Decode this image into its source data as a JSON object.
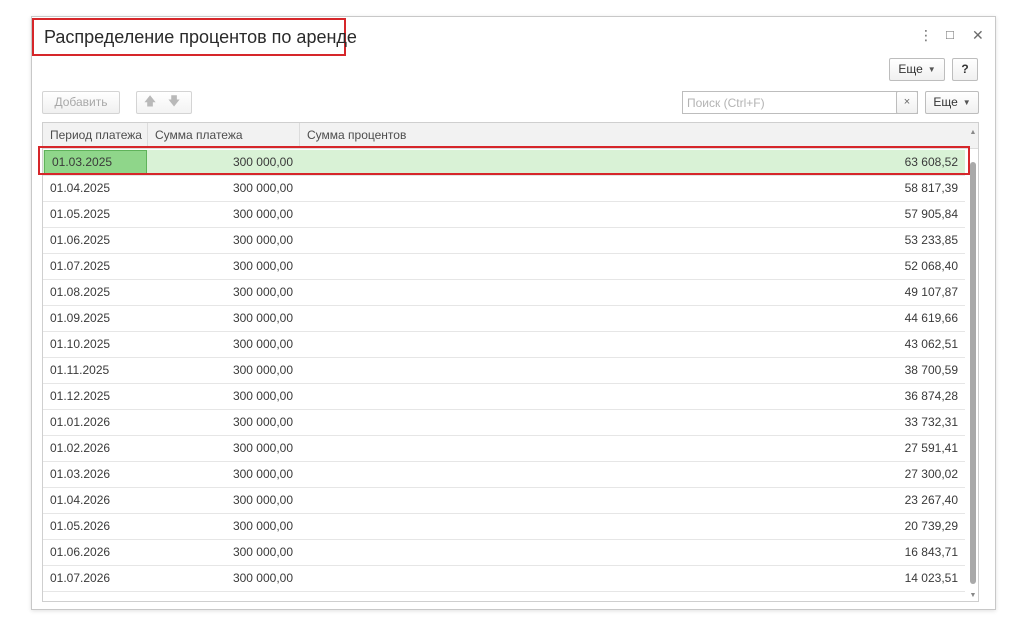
{
  "window": {
    "title": "Распределение процентов по аренде",
    "menu_icon": "⋮",
    "maximize_icon": "□",
    "close_icon": "✕"
  },
  "top_toolbar": {
    "more_label": "Еще",
    "help_label": "?"
  },
  "toolbar": {
    "add_label": "Добавить",
    "move_up_icon": "🡅",
    "move_down_icon": "🡇",
    "search_placeholder": "Поиск (Ctrl+F)",
    "search_clear_icon": "×",
    "more_label": "Еще"
  },
  "table": {
    "columns": [
      "Период платежа",
      "Сумма платежа",
      "Сумма процентов"
    ],
    "rows": [
      {
        "period": "01.03.2025",
        "payment": "300 000,00",
        "interest": "63 608,52"
      },
      {
        "period": "01.04.2025",
        "payment": "300 000,00",
        "interest": "58 817,39"
      },
      {
        "period": "01.05.2025",
        "payment": "300 000,00",
        "interest": "57 905,84"
      },
      {
        "period": "01.06.2025",
        "payment": "300 000,00",
        "interest": "53 233,85"
      },
      {
        "period": "01.07.2025",
        "payment": "300 000,00",
        "interest": "52 068,40"
      },
      {
        "period": "01.08.2025",
        "payment": "300 000,00",
        "interest": "49 107,87"
      },
      {
        "period": "01.09.2025",
        "payment": "300 000,00",
        "interest": "44 619,66"
      },
      {
        "period": "01.10.2025",
        "payment": "300 000,00",
        "interest": "43 062,51"
      },
      {
        "period": "01.11.2025",
        "payment": "300 000,00",
        "interest": "38 700,59"
      },
      {
        "period": "01.12.2025",
        "payment": "300 000,00",
        "interest": "36 874,28"
      },
      {
        "period": "01.01.2026",
        "payment": "300 000,00",
        "interest": "33 732,31"
      },
      {
        "period": "01.02.2026",
        "payment": "300 000,00",
        "interest": "27 591,41"
      },
      {
        "period": "01.03.2026",
        "payment": "300 000,00",
        "interest": "27 300,02"
      },
      {
        "period": "01.04.2026",
        "payment": "300 000,00",
        "interest": "23 267,40"
      },
      {
        "period": "01.05.2026",
        "payment": "300 000,00",
        "interest": "20 739,29"
      },
      {
        "period": "01.06.2026",
        "payment": "300 000,00",
        "interest": "16 843,71"
      },
      {
        "period": "01.07.2026",
        "payment": "300 000,00",
        "interest": "14 023,51"
      }
    ],
    "selected_row": 0
  },
  "colors": {
    "highlight_frame": "#d6262a",
    "selected_row": "#d9f2d6",
    "selected_cell": "#8fd68a"
  }
}
